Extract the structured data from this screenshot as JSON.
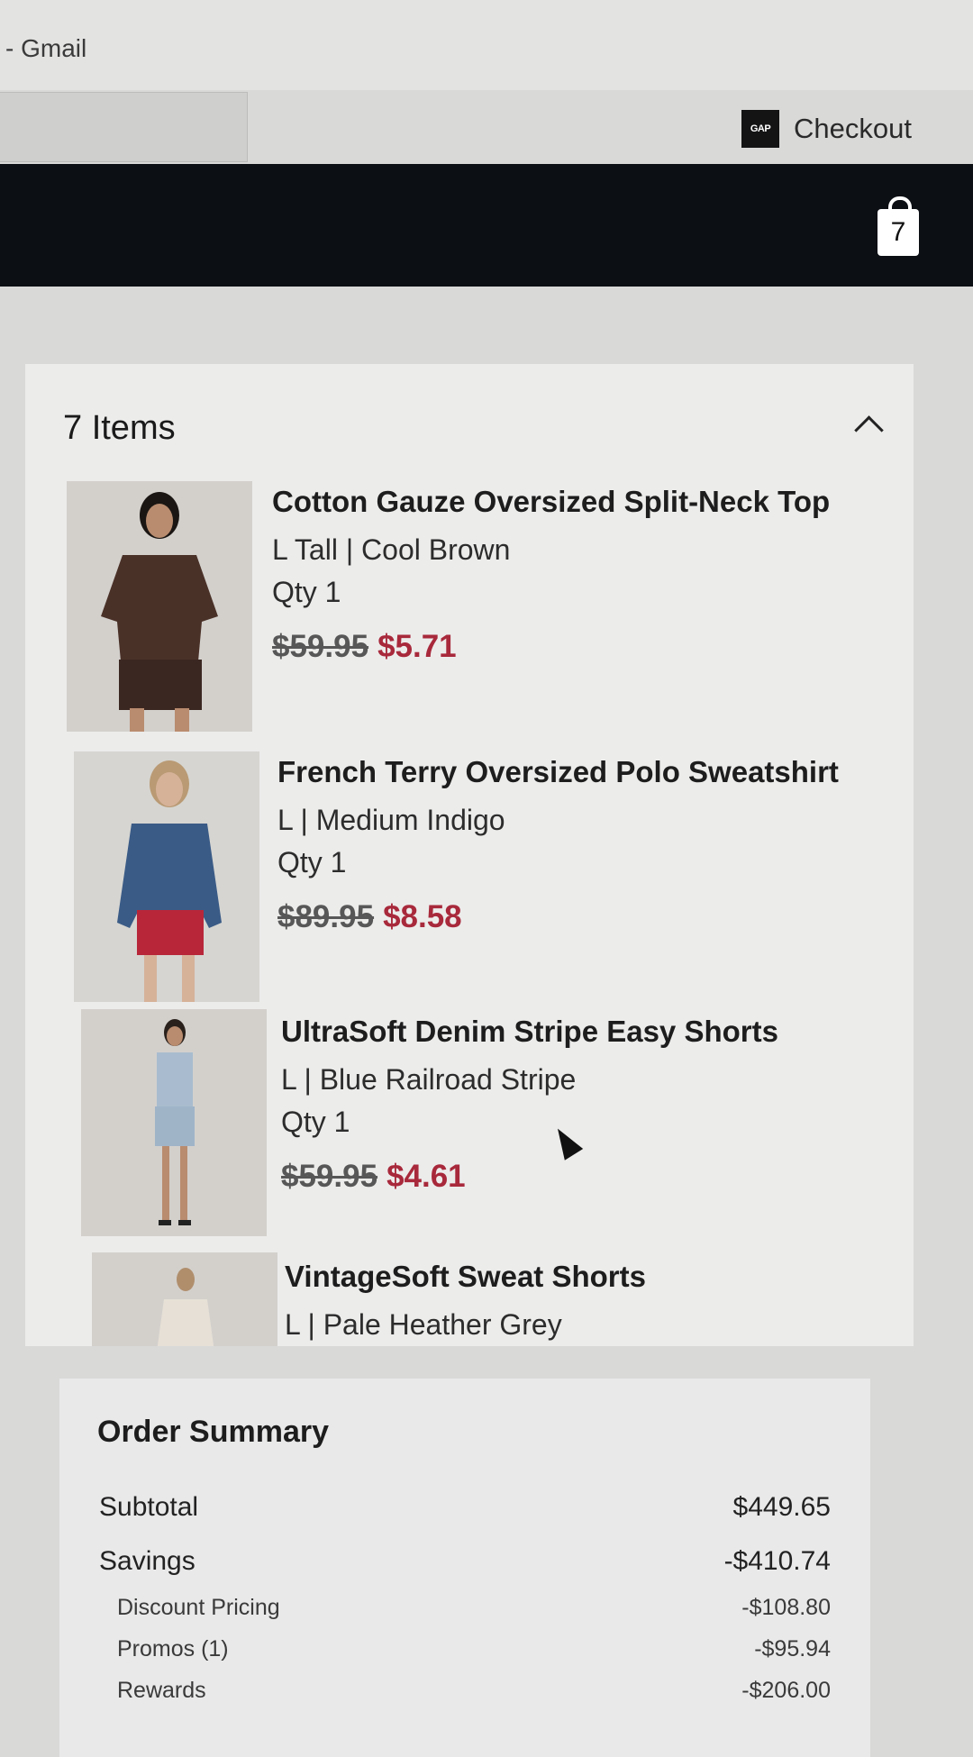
{
  "browser": {
    "tab_title": "- Gmail"
  },
  "header": {
    "logo_text": "GAP",
    "checkout_label": "Checkout"
  },
  "nav": {
    "bag_count": "7"
  },
  "cart": {
    "heading": "7 Items",
    "items": [
      {
        "name": "Cotton Gauze Oversized Split-Neck Top",
        "variant": "L Tall | Cool Brown",
        "qty": "Qty 1",
        "was": "$59.95",
        "now": "$5.71"
      },
      {
        "name": "French Terry Oversized Polo Sweatshirt",
        "variant": "L | Medium Indigo",
        "qty": "Qty 1",
        "was": "$89.95",
        "now": "$8.58"
      },
      {
        "name": "UltraSoft Denim Stripe Easy Shorts",
        "variant": "L | Blue Railroad Stripe",
        "qty": "Qty 1",
        "was": "$59.95",
        "now": "$4.61"
      },
      {
        "name": "VintageSoft Sweat Shorts",
        "variant": "L | Pale Heather Grey"
      }
    ]
  },
  "summary": {
    "title": "Order Summary",
    "subtotal_label": "Subtotal",
    "subtotal_value": "$449.65",
    "savings_label": "Savings",
    "savings_value": "-$410.74",
    "discount_label": "Discount Pricing",
    "discount_value": "-$108.80",
    "promos_label": "Promos (1)",
    "promos_value": "-$95.94",
    "rewards_label": "Rewards",
    "rewards_value": "-$206.00"
  },
  "colors": {
    "sale_price": "#a8293b",
    "nav_bg": "#0c0f14"
  }
}
